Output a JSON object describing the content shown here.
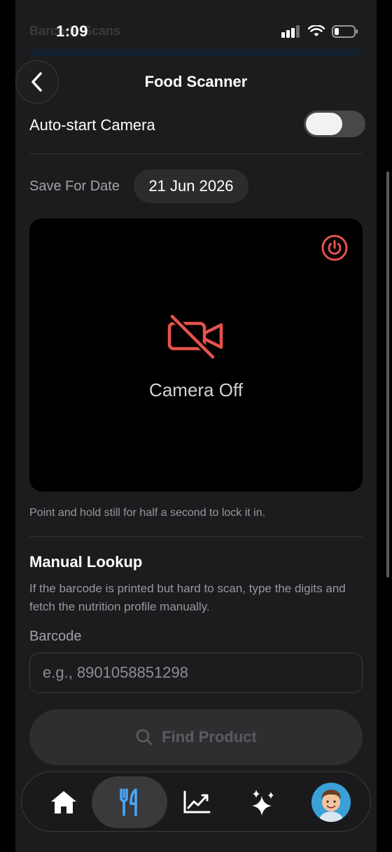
{
  "status_bar": {
    "time": "1:09"
  },
  "background_page": {
    "title": "Barcode Scans"
  },
  "header": {
    "title": "Food Scanner"
  },
  "settings": {
    "auto_start_label": "Auto-start Camera",
    "auto_start_enabled": false,
    "save_for_date_label": "Save For Date",
    "date_value": "21 Jun 2026"
  },
  "camera": {
    "status_text": "Camera Off",
    "hint": "Point and hold still for half a second to lock it in."
  },
  "manual_lookup": {
    "title": "Manual Lookup",
    "description": "If the barcode is printed but hard to scan, type the digits and fetch the nutrition profile manually.",
    "barcode_label": "Barcode",
    "barcode_placeholder": "e.g., 8901058851298",
    "barcode_value": "",
    "find_button_label": "Find Product"
  },
  "tabs": [
    {
      "icon": "home-icon",
      "active": false
    },
    {
      "icon": "fork-knife-icon",
      "active": true
    },
    {
      "icon": "chart-icon",
      "active": false
    },
    {
      "icon": "sparkles-icon",
      "active": false
    },
    {
      "icon": "profile-avatar",
      "active": false
    }
  ],
  "colors": {
    "accent_red": "#e5534b",
    "accent_blue": "#4aa8ff",
    "background": "#1c1c1e"
  }
}
